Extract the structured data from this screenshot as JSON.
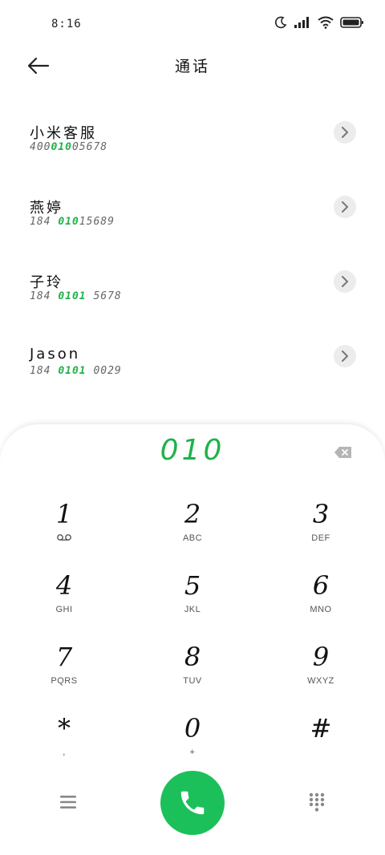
{
  "status_bar": {
    "time": "8:16",
    "icons": [
      "moon-icon",
      "signal-icon",
      "wifi-icon",
      "battery-icon"
    ]
  },
  "header": {
    "title": "通话",
    "back_icon": "arrow-left-icon"
  },
  "contacts": [
    {
      "name": "小米客服",
      "number_before": "400",
      "number_match": "010",
      "number_after": "05678"
    },
    {
      "name": "燕婷",
      "number_before": "184 ",
      "number_match": "010",
      "number_after": "15689"
    },
    {
      "name": "子玲",
      "number_before": "184 ",
      "number_match": "0101",
      "number_after": " 5678"
    },
    {
      "name": "Jason",
      "number_before": "184 ",
      "number_match": "0101",
      "number_after": " 0029"
    }
  ],
  "dialer": {
    "input_value": "010",
    "backspace_icon": "backspace-icon",
    "keys": [
      {
        "digit": "1",
        "letters": ""
      },
      {
        "digit": "2",
        "letters": "ABC"
      },
      {
        "digit": "3",
        "letters": "DEF"
      },
      {
        "digit": "4",
        "letters": "GHI"
      },
      {
        "digit": "5",
        "letters": "JKL"
      },
      {
        "digit": "6",
        "letters": "MNO"
      },
      {
        "digit": "7",
        "letters": "PQRS"
      },
      {
        "digit": "8",
        "letters": "TUV"
      },
      {
        "digit": "9",
        "letters": "WXYZ"
      },
      {
        "digit": "*",
        "letters": ","
      },
      {
        "digit": "0",
        "letters": "+"
      },
      {
        "digit": "#",
        "letters": ""
      }
    ],
    "voicemail_icon": "voicemail-icon"
  },
  "bottom_bar": {
    "menu_icon": "menu-icon",
    "call_icon": "phone-icon",
    "keypad_icon": "dialpad-icon"
  },
  "colors": {
    "accent": "#1fb24a",
    "call_button": "#1cc05b"
  }
}
